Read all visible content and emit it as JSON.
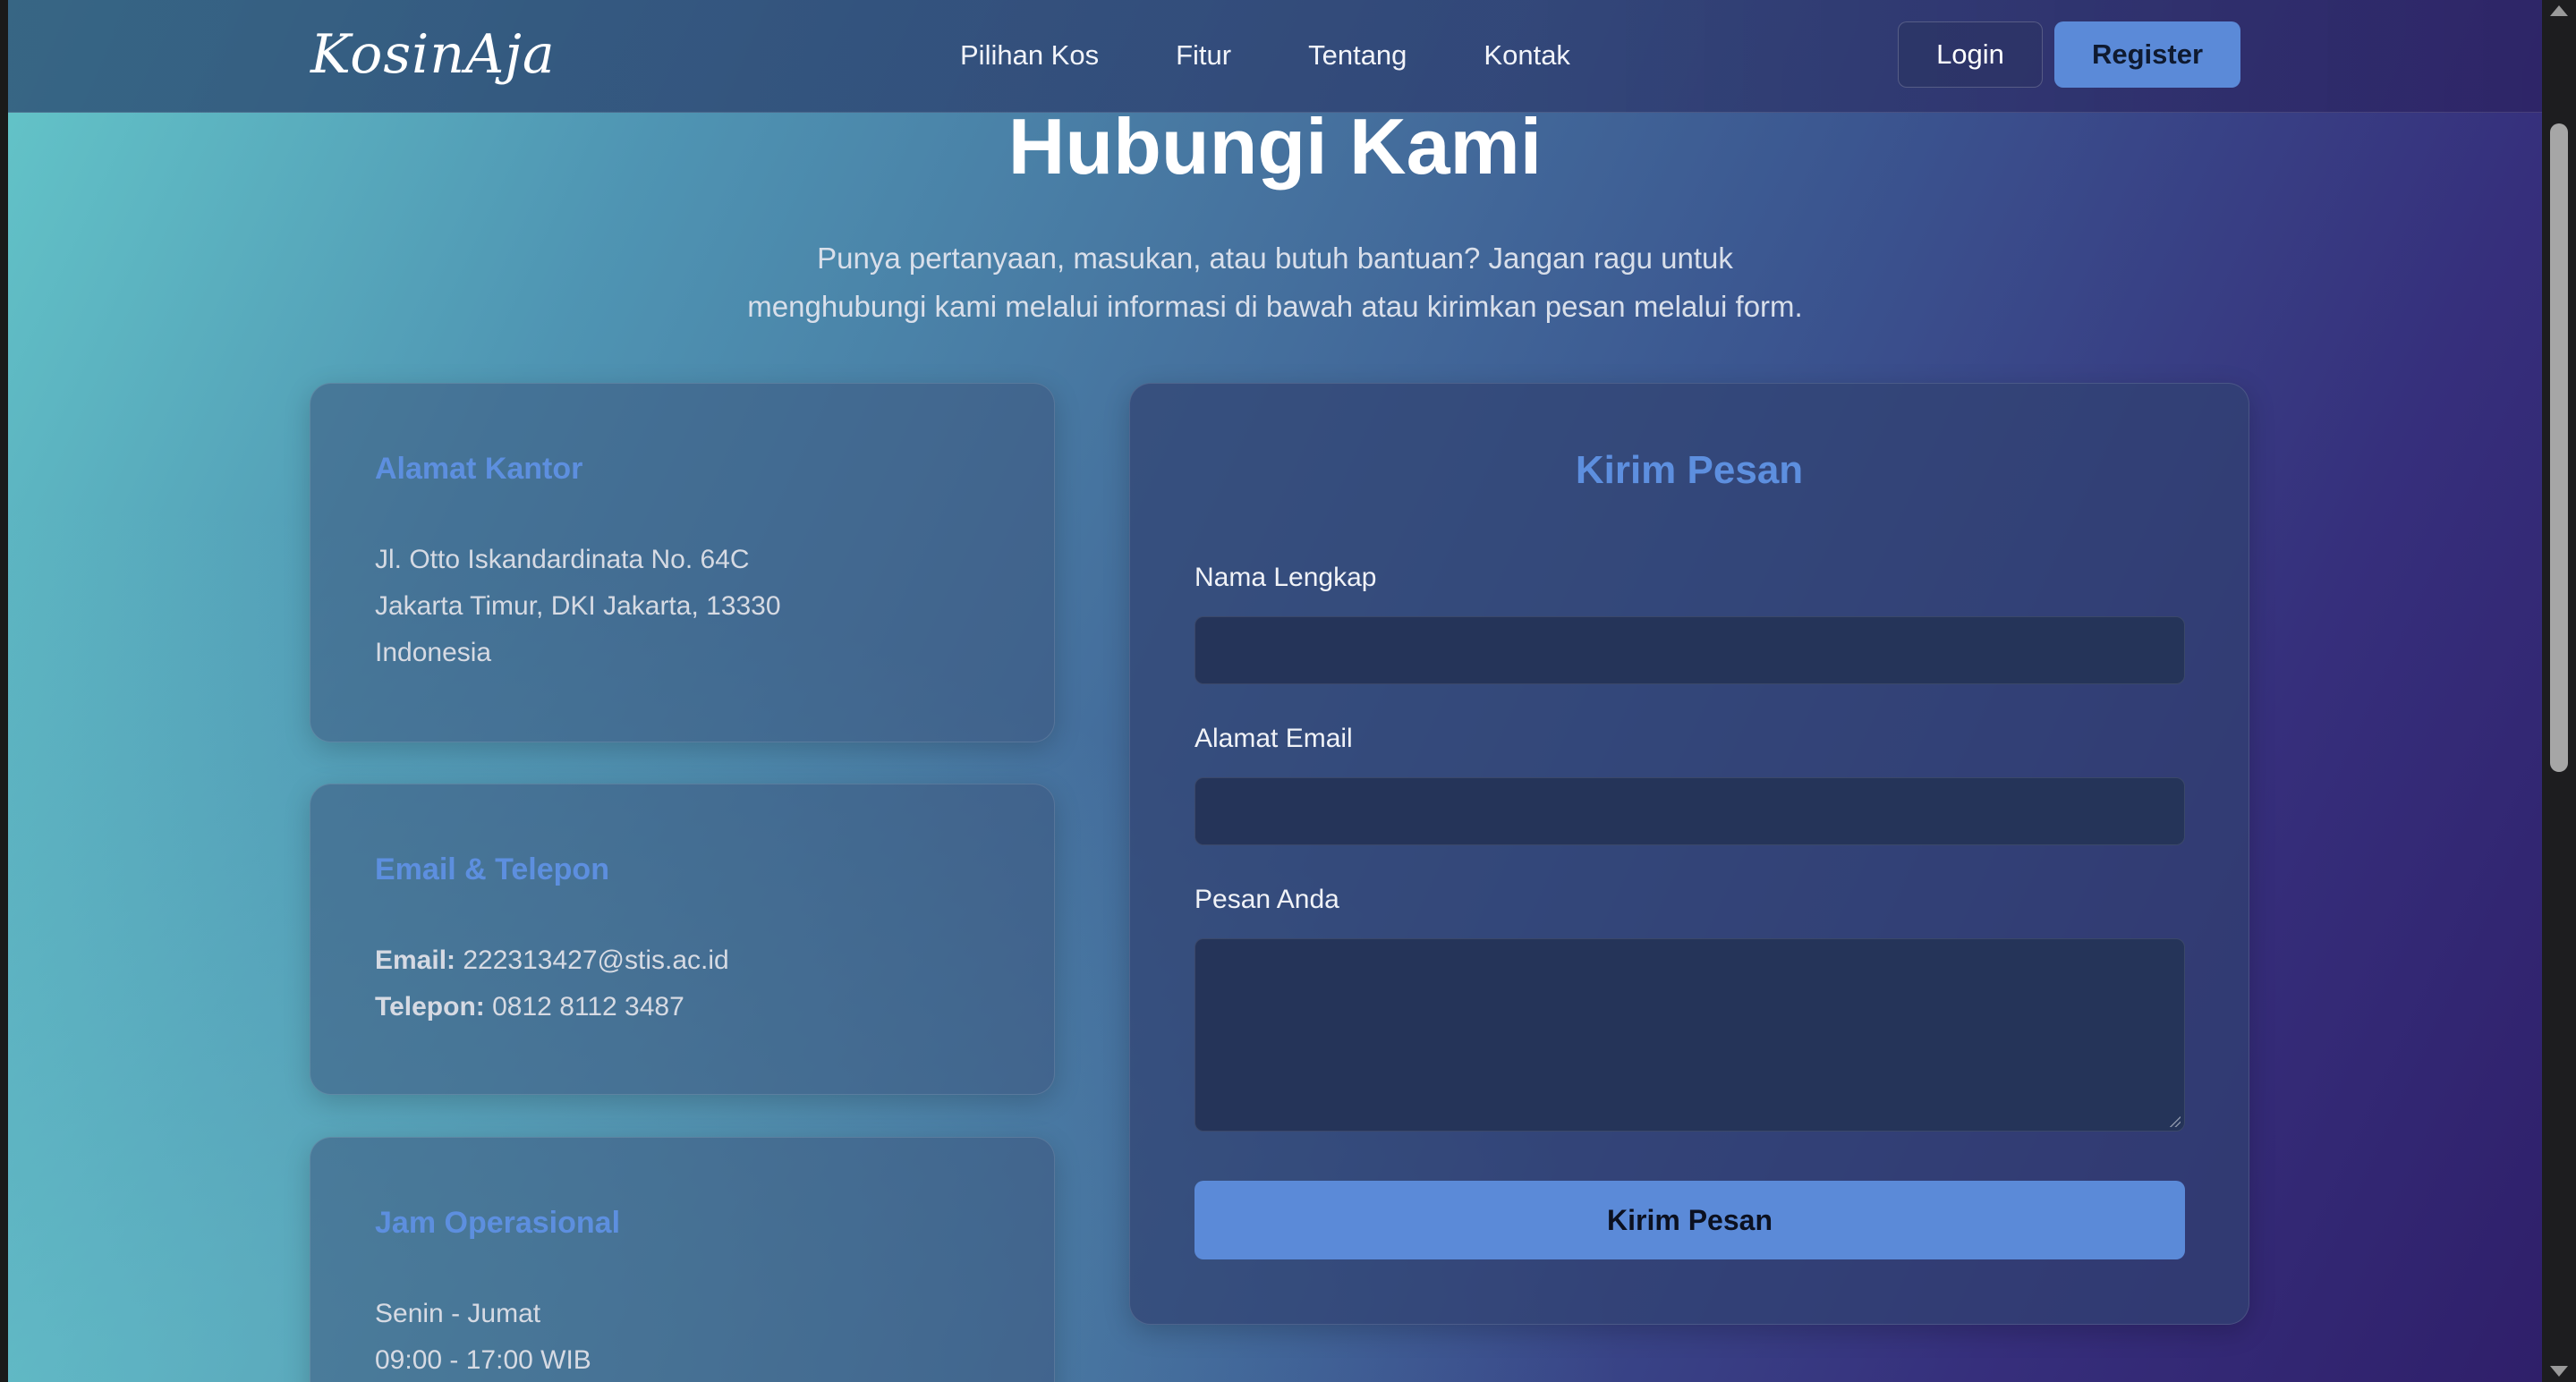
{
  "navbar": {
    "logo": "KosinAja",
    "links": [
      "Pilihan Kos",
      "Fitur",
      "Tentang",
      "Kontak"
    ],
    "login_label": "Login",
    "register_label": "Register"
  },
  "header": {
    "title": "Hubungi Kami",
    "subtitle_line1": "Punya pertanyaan, masukan, atau butuh bantuan? Jangan ragu untuk",
    "subtitle_line2": "menghubungi kami melalui informasi di bawah atau kirimkan pesan melalui form."
  },
  "cards": {
    "address": {
      "title": "Alamat Kantor",
      "lines": [
        "Jl. Otto Iskandardinata No. 64C",
        "Jakarta Timur, DKI Jakarta, 13330",
        "Indonesia"
      ]
    },
    "contact": {
      "title": "Email & Telepon",
      "email_label": "Email:",
      "email_value": "222313427@stis.ac.id",
      "phone_label": "Telepon:",
      "phone_value": "0812 8112 3487"
    },
    "hours": {
      "title": "Jam Operasional",
      "lines": [
        "Senin - Jumat",
        "09:00 - 17:00 WIB"
      ]
    }
  },
  "form": {
    "title": "Kirim Pesan",
    "name_label": "Nama Lengkap",
    "name_value": "",
    "email_label": "Alamat Email",
    "email_value": "",
    "message_label": "Pesan Anda",
    "message_value": "",
    "submit_label": "Kirim Pesan"
  },
  "colors": {
    "accent": "#5b8ad8",
    "card_title": "#5d8fdf",
    "input_bg": "#253459"
  }
}
